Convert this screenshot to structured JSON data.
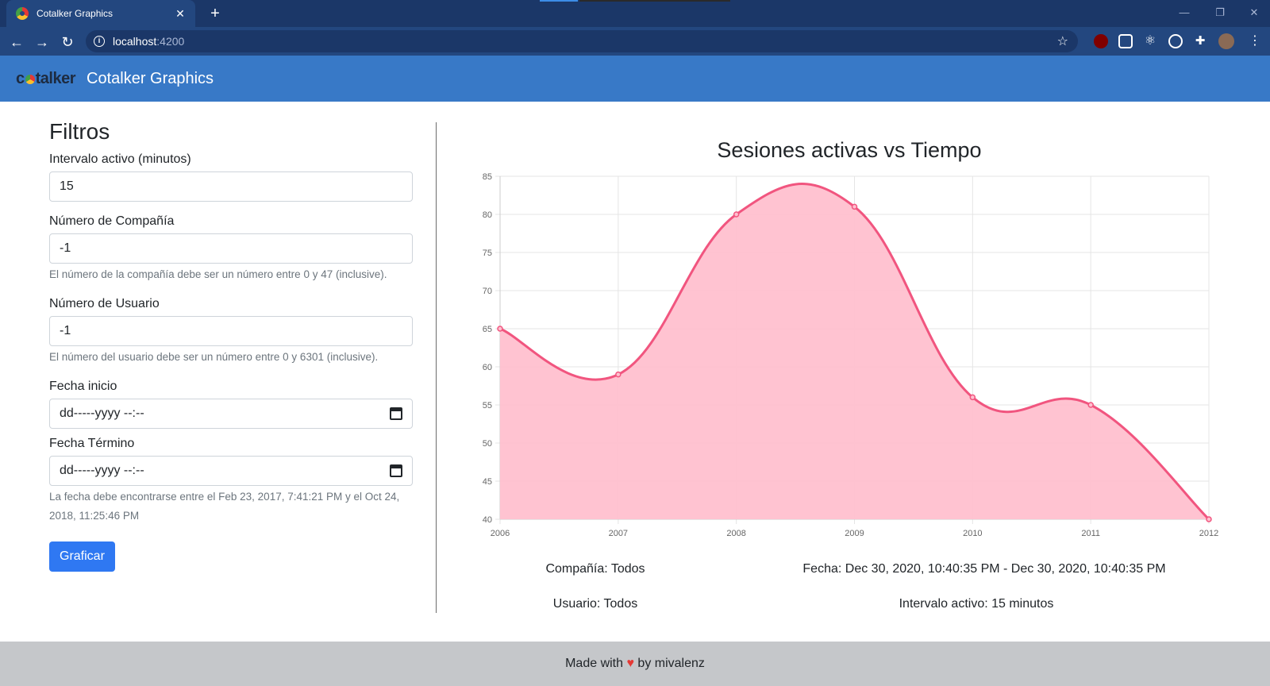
{
  "browser": {
    "tab_title": "Cotalker Graphics",
    "url_host": "localhost",
    "url_port": ":4200"
  },
  "navbar": {
    "logo_left": "c",
    "logo_right": "talker",
    "title": "Cotalker Graphics"
  },
  "filters": {
    "title": "Filtros",
    "interval": {
      "label": "Intervalo activo (minutos)",
      "value": "15"
    },
    "company": {
      "label": "Número de Compañía",
      "value": "-1",
      "help": "El número de la compañía debe ser un número entre 0 y 47 (inclusive)."
    },
    "user": {
      "label": "Número de Usuario",
      "value": "-1",
      "help": "El número del usuario debe ser un número entre 0 y 6301 (inclusive)."
    },
    "start_date": {
      "label": "Fecha inicio",
      "value": "dd-----yyyy --:--"
    },
    "end_date": {
      "label": "Fecha Término",
      "value": "dd-----yyyy --:--",
      "help": "La fecha debe encontrarse entre el Feb 23, 2017, 7:41:21 PM y el Oct 24, 2018, 11:25:46 PM"
    },
    "submit_label": "Graficar"
  },
  "chart_data": {
    "type": "area",
    "title": "Sesiones activas vs Tiempo",
    "x": [
      "2006",
      "2007",
      "2008",
      "2009",
      "2010",
      "2011",
      "2012"
    ],
    "series": [
      {
        "values": [
          65,
          59,
          80,
          81,
          56,
          55,
          40
        ]
      }
    ],
    "ylim": [
      40,
      85
    ],
    "yticks": [
      85,
      80,
      75,
      70,
      65,
      60,
      55,
      50,
      45,
      40
    ],
    "grid": true,
    "colors": {
      "line": "#f1557f",
      "fill": "#ffc0cf",
      "grid": "#e5e5e5"
    }
  },
  "summary": {
    "company": "Compañía: Todos",
    "date": "Fecha: Dec 30, 2020, 10:40:35 PM - Dec 30, 2020, 10:40:35 PM",
    "user": "Usuario: Todos",
    "interval": "Intervalo activo: 15 minutos"
  },
  "footer": {
    "prefix": "Made with",
    "heart": "♥",
    "suffix": "by mivalenz"
  }
}
